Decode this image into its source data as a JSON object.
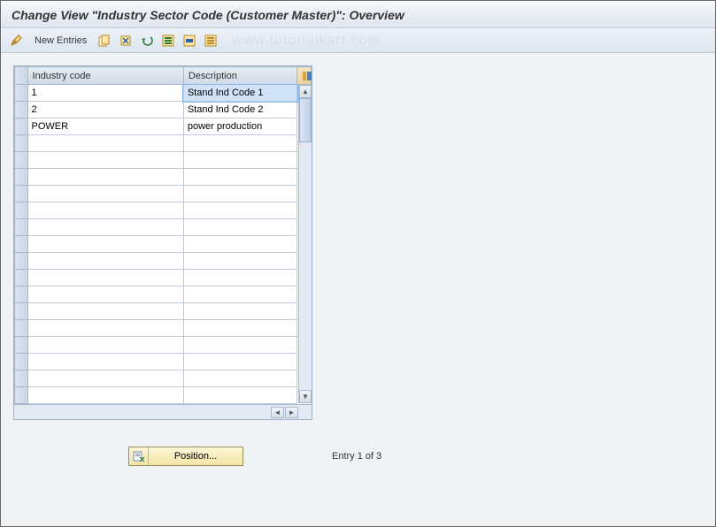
{
  "title": "Change View \"Industry Sector Code (Customer Master)\": Overview",
  "toolbar": {
    "new_entries": "New Entries"
  },
  "watermark": "www.tutorialkart.com",
  "table": {
    "columns": {
      "code": "Industry code",
      "desc": "Description"
    },
    "rows": [
      {
        "code": "1",
        "desc": "Stand Ind Code 1",
        "selected": true
      },
      {
        "code": "2",
        "desc": "Stand Ind Code 2",
        "selected": false
      },
      {
        "code": "POWER",
        "desc": "power production",
        "selected": false
      }
    ],
    "empty_rows": 16
  },
  "footer": {
    "position_label": "Position...",
    "entry_text": "Entry 1 of 3"
  }
}
